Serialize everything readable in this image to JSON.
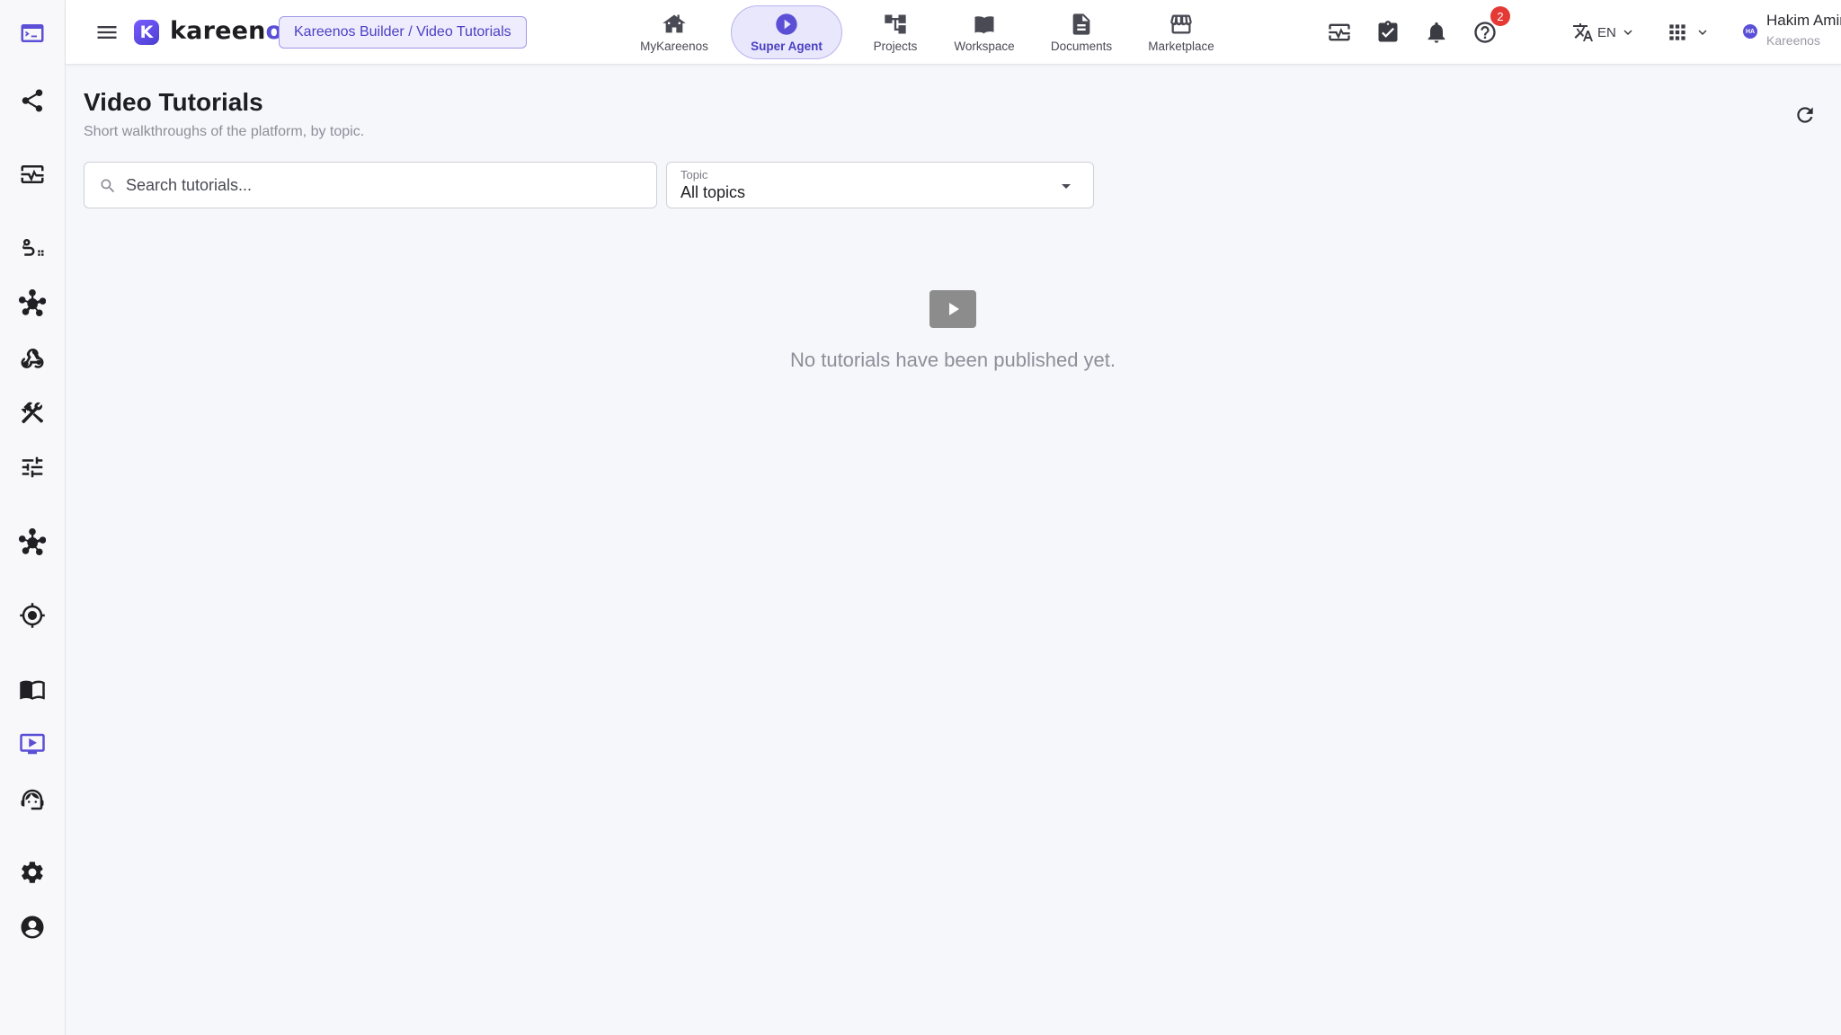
{
  "app": {
    "logo_mark": "K",
    "logo_name_part1": "kareen",
    "logo_name_part2": "os",
    "breadcrumb": "Kareenos Builder / Video Tutorials"
  },
  "nav": [
    {
      "label": "MyKareenos",
      "icon": "home-icon"
    },
    {
      "label": "Super Agent",
      "icon": "play-circle-icon",
      "active": true
    },
    {
      "label": "Projects",
      "icon": "hierarchy-icon"
    },
    {
      "label": "Workspace",
      "icon": "book-open-icon"
    },
    {
      "label": "Documents",
      "icon": "document-icon"
    },
    {
      "label": "Marketplace",
      "icon": "storefront-icon"
    }
  ],
  "topbar": {
    "notification_count": "2",
    "language": "EN"
  },
  "user": {
    "name": "Hakim Amir",
    "org": "Kareenos",
    "initials": "HA"
  },
  "sidebar": [
    "terminal-icon",
    "share-icon",
    "monitor-heart-icon",
    "route-icon",
    "hub-icon",
    "webhook-icon",
    "tools-icon",
    "tune-icon",
    "hub-icon",
    "target-icon",
    "book-icon",
    "video-library-icon",
    "support-agent-icon",
    "settings-icon",
    "account-icon"
  ],
  "page": {
    "title": "Video Tutorials",
    "subtitle": "Short walkthroughs of the platform, by topic."
  },
  "filters": {
    "search_placeholder": "Search tutorials...",
    "search_value": "",
    "topic_label": "Topic",
    "topic_value": "All topics"
  },
  "empty_state": {
    "message": "No tutorials have been published yet."
  },
  "colors": {
    "accent": "#5b4fd6",
    "badge": "#e53935",
    "background": "#f6f7fb"
  }
}
